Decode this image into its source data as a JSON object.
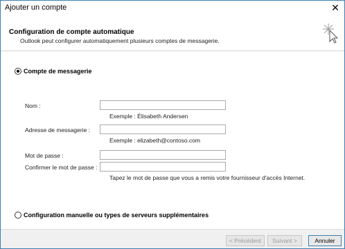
{
  "window": {
    "title": "Ajouter un compte",
    "close_glyph": "✕"
  },
  "header": {
    "title": "Configuration de compte automatique",
    "subtitle": "Outlook peut configurer automatiquement plusieurs comptes de messagerie.",
    "icon": "wizard-cursor-icon"
  },
  "email_option": {
    "label": "Compte de messagerie",
    "selected": true
  },
  "form": {
    "name_label": "Nom :",
    "name_value": "",
    "name_hint": "Exemple : Élisabeth Andersen",
    "email_label": "Adresse de messagerie :",
    "email_value": "",
    "email_hint": "Exemple : elizabeth@contoso.com",
    "password_label": "Mot de passe :",
    "password_value": "",
    "confirm_label": "Confirmer le mot de passe :",
    "confirm_value": "",
    "password_hint": "Tapez le mot de passe que vous a remis votre fournisseur d'accès Internet."
  },
  "manual_option": {
    "label": "Configuration manuelle ou types de serveurs supplémentaires",
    "selected": false
  },
  "footer": {
    "back_label": "< Précédent",
    "next_label": "Suivant >",
    "cancel_label": "Annuler"
  },
  "colors": {
    "accent": "#3c7fb1",
    "footer_bg": "#f0f0f0",
    "disabled_text": "#9a9a9a"
  }
}
